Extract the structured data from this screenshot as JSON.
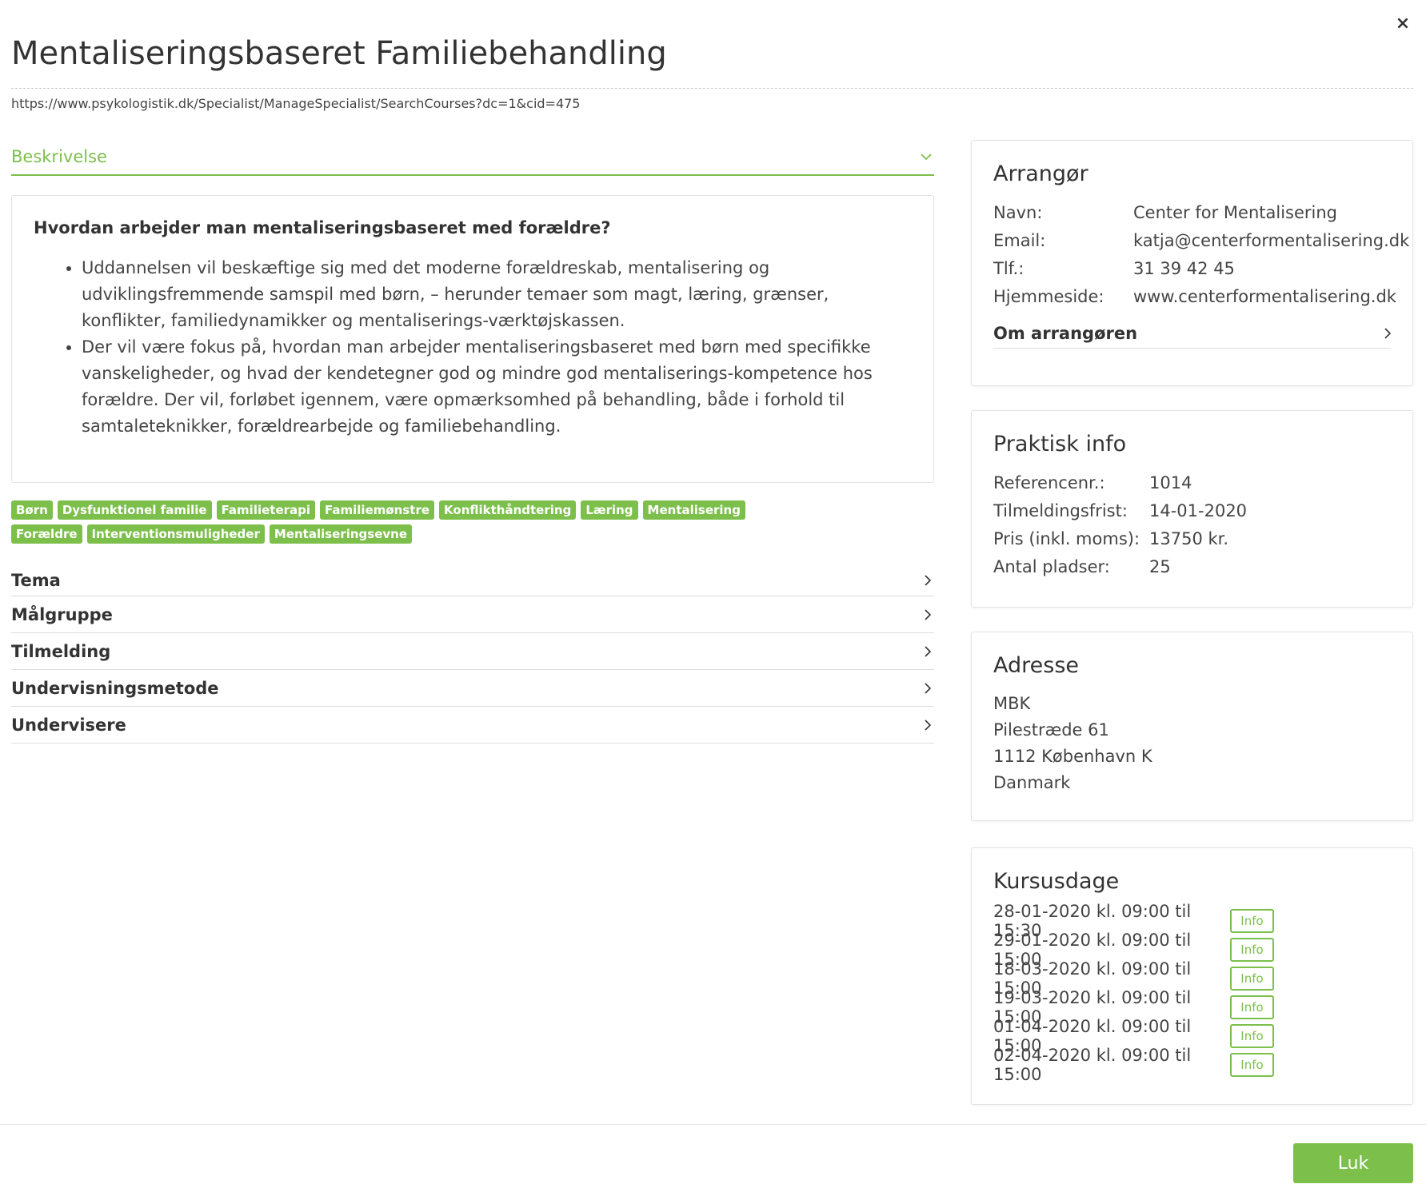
{
  "title": "Mentaliseringsbaseret Familiebehandling",
  "url": "https://www.psykologistik.dk/Specialist/ManageSpecialist/SearchCourses?dc=1&cid=475",
  "description": {
    "header": "Beskrivelse",
    "heading": "Hvordan arbejder man mentaliseringsbaseret med forældre?",
    "bullets": [
      "Uddannelsen vil beskæftige sig med det moderne forældreskab, mentalisering og udviklingsfremmende samspil med børn, – herunder temaer som magt, læring, grænser, konflikter, familiedynamikker og mentaliserings-værktøjskassen.",
      "Der vil være fokus på, hvordan man arbejder mentaliseringsbaseret med børn med specifikke vanskeligheder, og hvad der kendetegner god og mindre god mentaliserings-kompetence hos forældre. Der vil, forløbet igennem, være opmærksomhed på behandling, både i forhold til samtaleteknikker, forældrearbejde og familiebehandling."
    ]
  },
  "tags": [
    "Børn",
    "Dysfunktionel familie",
    "Familieterapi",
    "Familiemønstre",
    "Konflikthåndtering",
    "Læring",
    "Mentalisering",
    "Forældre",
    "Interventionsmuligheder",
    "Mentaliseringsevne"
  ],
  "accordion": [
    "Tema",
    "Målgruppe",
    "Tilmelding",
    "Undervisningsmetode",
    "Undervisere"
  ],
  "organizer": {
    "title": "Arrangør",
    "rows": [
      {
        "k": "Navn:",
        "v": "Center for Mentalisering"
      },
      {
        "k": "Email:",
        "v": "katja@centerformentalisering.dk"
      },
      {
        "k": "Tlf.:",
        "v": "31 39 42 45"
      },
      {
        "k": "Hjemmeside:",
        "v": "www.centerformentalisering.dk"
      }
    ],
    "about": "Om arrangøren"
  },
  "practical": {
    "title": "Praktisk info",
    "rows": [
      {
        "k": "Referencenr.:",
        "v": "1014"
      },
      {
        "k": "Tilmeldingsfrist:",
        "v": "14-01-2020"
      },
      {
        "k": "Pris (inkl. moms):",
        "v": "13750 kr."
      },
      {
        "k": "Antal pladser:",
        "v": "25"
      }
    ]
  },
  "address": {
    "title": "Adresse",
    "lines": [
      "MBK",
      "Pilestræde 61",
      "1112 København K",
      "Danmark"
    ]
  },
  "course_days": {
    "title": "Kursusdage",
    "info_label": "Info",
    "days": [
      "28-01-2020 kl. 09:00 til 15:30",
      "29-01-2020 kl. 09:00 til 15:00",
      "18-03-2020 kl. 09:00 til 15:00",
      "19-03-2020 kl. 09:00 til 15:00",
      "01-04-2020 kl. 09:00 til 15:00",
      "02-04-2020 kl. 09:00 til 15:00"
    ]
  },
  "close_button": "Luk",
  "close_icon": "×",
  "colors": {
    "accent": "#7cbf4b",
    "text": "#333333",
    "border": "#e3e3e3"
  },
  "icons": {
    "close": "close-icon",
    "expand": "chevron-down-icon",
    "collapsed": "chevron-right-icon"
  }
}
